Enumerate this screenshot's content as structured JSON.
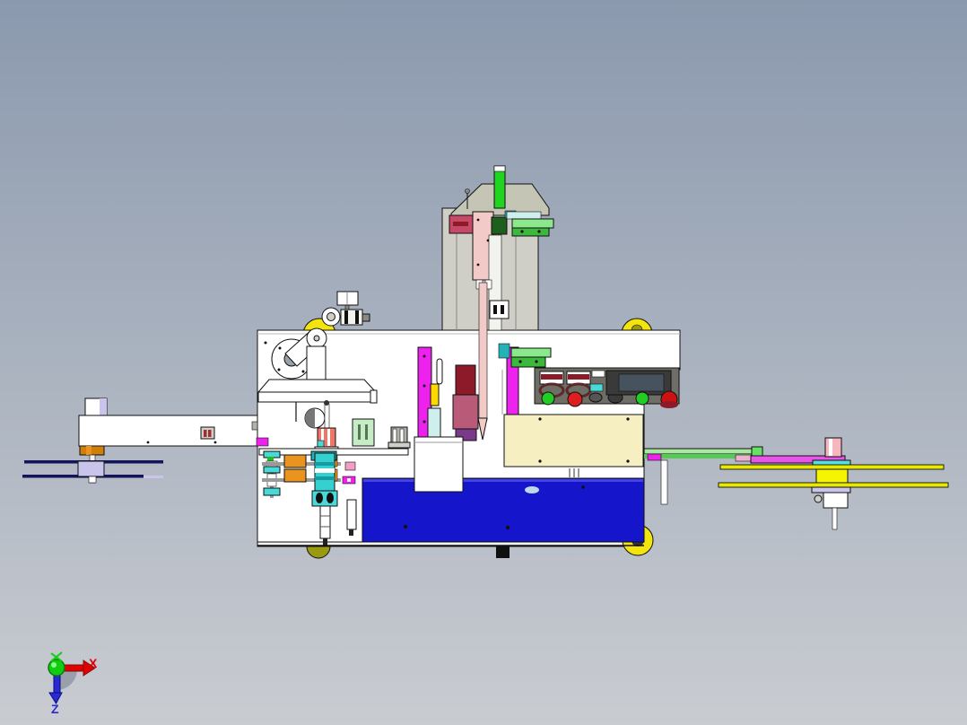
{
  "viewport": {
    "type": "cad-3d-view",
    "content": "packaging-labeling-machine-side-view"
  },
  "axis_triad": {
    "x_label": "X",
    "z_label": "Z",
    "x_color": "#dd0000",
    "y_color": "#11cc11",
    "z_color": "#2a2ad0"
  },
  "colors": {
    "bg_top": "#8b99ae",
    "bg_bottom": "#c9ccd1",
    "outline": "#101010",
    "white": "#ffffff",
    "offwhite": "#f2f2ee",
    "gray_light": "#cfcfc8",
    "gray_mid": "#b2b2aa",
    "gray_dark": "#8a8a82",
    "steel": "#9aa0ab",
    "panel": "#6e6e66",
    "beige": "#c5c5b5",
    "pale_yellow": "#f5efc2",
    "yellow": "#f2e40c",
    "yellow_bright": "#f5f500",
    "olive": "#9a9a10",
    "green_bright": "#21d421",
    "green_light": "#8ce88c",
    "green_mid": "#3cb83c",
    "green_dark": "#1e5f1e",
    "green_pale": "#c6ecc6",
    "cyan": "#4ad9d9",
    "cyan_pale": "#cfeeee",
    "teal": "#22b2b8",
    "blue": "#1515cc",
    "blue_light": "#4444e0",
    "navy": "#13135e",
    "magenta": "#ee22ee",
    "pink": "#f6b6c0",
    "pink_pale": "#f2cbc8",
    "coral": "#ee7868",
    "mauve": "#b85a78",
    "crimson": "#c84868",
    "dark_red": "#8c1a28",
    "red": "#df1f1f",
    "orange": "#e8941e",
    "copper": "#d07f0c",
    "lavender": "#c9c4ec",
    "lcd": "#46525e",
    "axis_red": "#dd0000",
    "axis_green": "#11cc11",
    "axis_blue": "#2a2ad0"
  }
}
